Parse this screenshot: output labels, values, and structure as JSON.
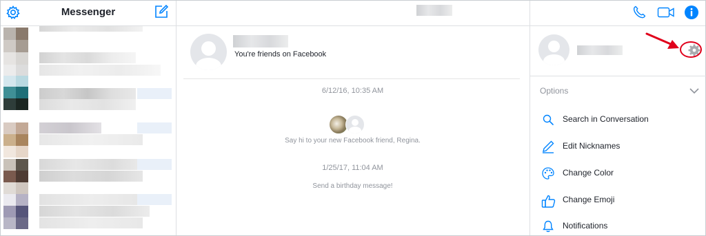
{
  "sidebar": {
    "title": "Messenger"
  },
  "conversation": {
    "friends_note": "You're friends on Facebook",
    "timestamps": [
      "6/12/16, 10:35 AM",
      "1/25/17, 11:04 AM"
    ],
    "system_messages": [
      "Say hi to your new Facebook friend, Regina.",
      "Send a birthday message!"
    ]
  },
  "details_panel": {
    "options_label": "Options",
    "options": [
      {
        "label": "Search in Conversation",
        "icon": "search-icon"
      },
      {
        "label": "Edit Nicknames",
        "icon": "pencil-icon"
      },
      {
        "label": "Change Color",
        "icon": "palette-icon"
      },
      {
        "label": "Change Emoji",
        "icon": "thumbs-up-icon"
      },
      {
        "label": "Notifications",
        "icon": "bell-icon"
      }
    ]
  },
  "colors": {
    "accent": "#0084ff",
    "annotation": "#e0001b",
    "muted_text": "#90949c",
    "border": "#dddfe2"
  }
}
